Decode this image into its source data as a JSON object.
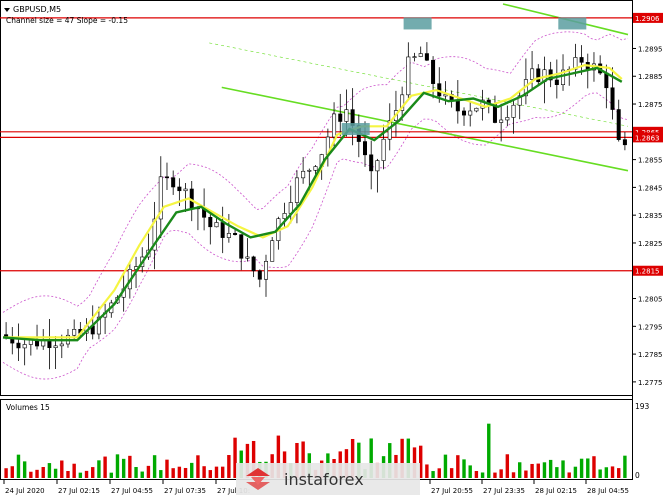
{
  "header": {
    "symbol": "GBPUSD,M5",
    "channel": "Channel size = 47 Slope = -0.15"
  },
  "volume_panel": {
    "title": "Volumes 15",
    "max_label": "193",
    "zero_label": "0"
  },
  "watermark": {
    "brand": "instaforex"
  },
  "colors": {
    "background": "#ffffff",
    "bull_candle": "#000000",
    "bear_candle": "#000000",
    "ma_fast": "#f5f542",
    "ma_slow": "#1a8a1a",
    "channel_line": "#66dd22",
    "bollinger": "#cc55cc",
    "level_line": "#dd0000",
    "signal_box": "#5a9ea0",
    "vol_up": "#00aa00",
    "vol_down": "#dd0000"
  },
  "chart_data": {
    "type": "candlestick",
    "symbol": "GBPUSD",
    "timeframe": "M5",
    "y_axis": {
      "ticks": [
        "1.2895",
        "1.2885",
        "1.2875",
        "1.2855",
        "1.2845",
        "1.2835",
        "1.2825",
        "1.2805",
        "1.2795",
        "1.2785",
        "1.2775"
      ],
      "ylim": [
        1.2771,
        1.2911
      ]
    },
    "x_axis": {
      "ticks": [
        "24 Jul 2020",
        "27 Jul 02:15",
        "27 Jul 04:55",
        "27 Jul 07:35",
        "27 Jul 10:",
        "27 Jul 20:55",
        "27 Jul 23:35",
        "28 Jul 02:15",
        "28 Jul 04:55"
      ]
    },
    "horizontal_levels": [
      {
        "label": "1.2906",
        "value": 1.2906
      },
      {
        "label": "1.2865",
        "value": 1.2865
      },
      {
        "label": "1.2863",
        "value": 1.2863
      },
      {
        "label": "1.2815",
        "value": 1.2815
      }
    ],
    "price_path": [
      [
        0,
        1.2792
      ],
      [
        4,
        1.2789
      ],
      [
        8,
        1.279
      ],
      [
        12,
        1.2791
      ],
      [
        16,
        1.2796
      ],
      [
        20,
        1.2809
      ],
      [
        24,
        1.2824
      ],
      [
        26,
        1.2846
      ],
      [
        28,
        1.2848
      ],
      [
        30,
        1.2843
      ],
      [
        32,
        1.2838
      ],
      [
        34,
        1.2831
      ],
      [
        36,
        1.2829
      ],
      [
        38,
        1.2826
      ],
      [
        40,
        1.2818
      ],
      [
        42,
        1.2812
      ],
      [
        44,
        1.2828
      ],
      [
        46,
        1.2838
      ],
      [
        48,
        1.2847
      ],
      [
        50,
        1.2852
      ],
      [
        52,
        1.2858
      ],
      [
        54,
        1.2869
      ],
      [
        56,
        1.2873
      ],
      [
        58,
        1.2862
      ],
      [
        60,
        1.2848
      ],
      [
        62,
        1.2862
      ],
      [
        64,
        1.2873
      ],
      [
        66,
        1.2889
      ],
      [
        68,
        1.2893
      ],
      [
        70,
        1.2883
      ],
      [
        72,
        1.2876
      ],
      [
        74,
        1.2873
      ],
      [
        76,
        1.2874
      ],
      [
        78,
        1.2875
      ],
      [
        80,
        1.287
      ],
      [
        82,
        1.2873
      ],
      [
        84,
        1.2878
      ],
      [
        86,
        1.2885
      ],
      [
        88,
        1.2886
      ],
      [
        90,
        1.2884
      ],
      [
        92,
        1.2887
      ],
      [
        94,
        1.2891
      ],
      [
        96,
        1.2888
      ],
      [
        98,
        1.2883
      ],
      [
        100,
        1.286
      ],
      [
        101,
        1.2858
      ]
    ],
    "fast_ma": [
      [
        0,
        1.2791
      ],
      [
        6,
        1.279
      ],
      [
        12,
        1.279
      ],
      [
        18,
        1.2803
      ],
      [
        24,
        1.2823
      ],
      [
        28,
        1.2836
      ],
      [
        32,
        1.2838
      ],
      [
        36,
        1.2832
      ],
      [
        40,
        1.2827
      ],
      [
        44,
        1.2829
      ],
      [
        48,
        1.2839
      ],
      [
        52,
        1.2855
      ],
      [
        56,
        1.2866
      ],
      [
        60,
        1.2862
      ],
      [
        64,
        1.2869
      ],
      [
        68,
        1.2879
      ],
      [
        72,
        1.2876
      ],
      [
        76,
        1.2877
      ],
      [
        80,
        1.2874
      ],
      [
        84,
        1.2878
      ],
      [
        88,
        1.2884
      ],
      [
        92,
        1.2886
      ],
      [
        96,
        1.2888
      ],
      [
        100,
        1.2883
      ]
    ],
    "slow_ma": [
      [
        0,
        1.2791
      ],
      [
        6,
        1.2791
      ],
      [
        12,
        1.2791
      ],
      [
        18,
        1.2808
      ],
      [
        22,
        1.2824
      ],
      [
        26,
        1.2838
      ],
      [
        30,
        1.2841
      ],
      [
        34,
        1.2836
      ],
      [
        38,
        1.2831
      ],
      [
        42,
        1.2827
      ],
      [
        46,
        1.2831
      ],
      [
        50,
        1.2845
      ],
      [
        54,
        1.2864
      ],
      [
        58,
        1.2867
      ],
      [
        62,
        1.2867
      ],
      [
        66,
        1.2878
      ],
      [
        70,
        1.288
      ],
      [
        74,
        1.2877
      ],
      [
        78,
        1.2874
      ],
      [
        82,
        1.2877
      ],
      [
        86,
        1.2884
      ],
      [
        90,
        1.2886
      ],
      [
        94,
        1.2889
      ],
      [
        98,
        1.2888
      ],
      [
        100,
        1.2884
      ]
    ],
    "channel": [
      {
        "x1": 0.35,
        "y1": 1.2881,
        "x2": 1.0,
        "y2": 1.2851
      },
      {
        "x1": 0.8,
        "y1": 1.2911,
        "x2": 1.0,
        "y2": 1.29
      }
    ],
    "signal_markers": [
      {
        "x": 57,
        "y": 1.2866
      },
      {
        "x": 67,
        "y": 1.2904
      },
      {
        "x": 92,
        "y": 1.2904
      }
    ]
  }
}
